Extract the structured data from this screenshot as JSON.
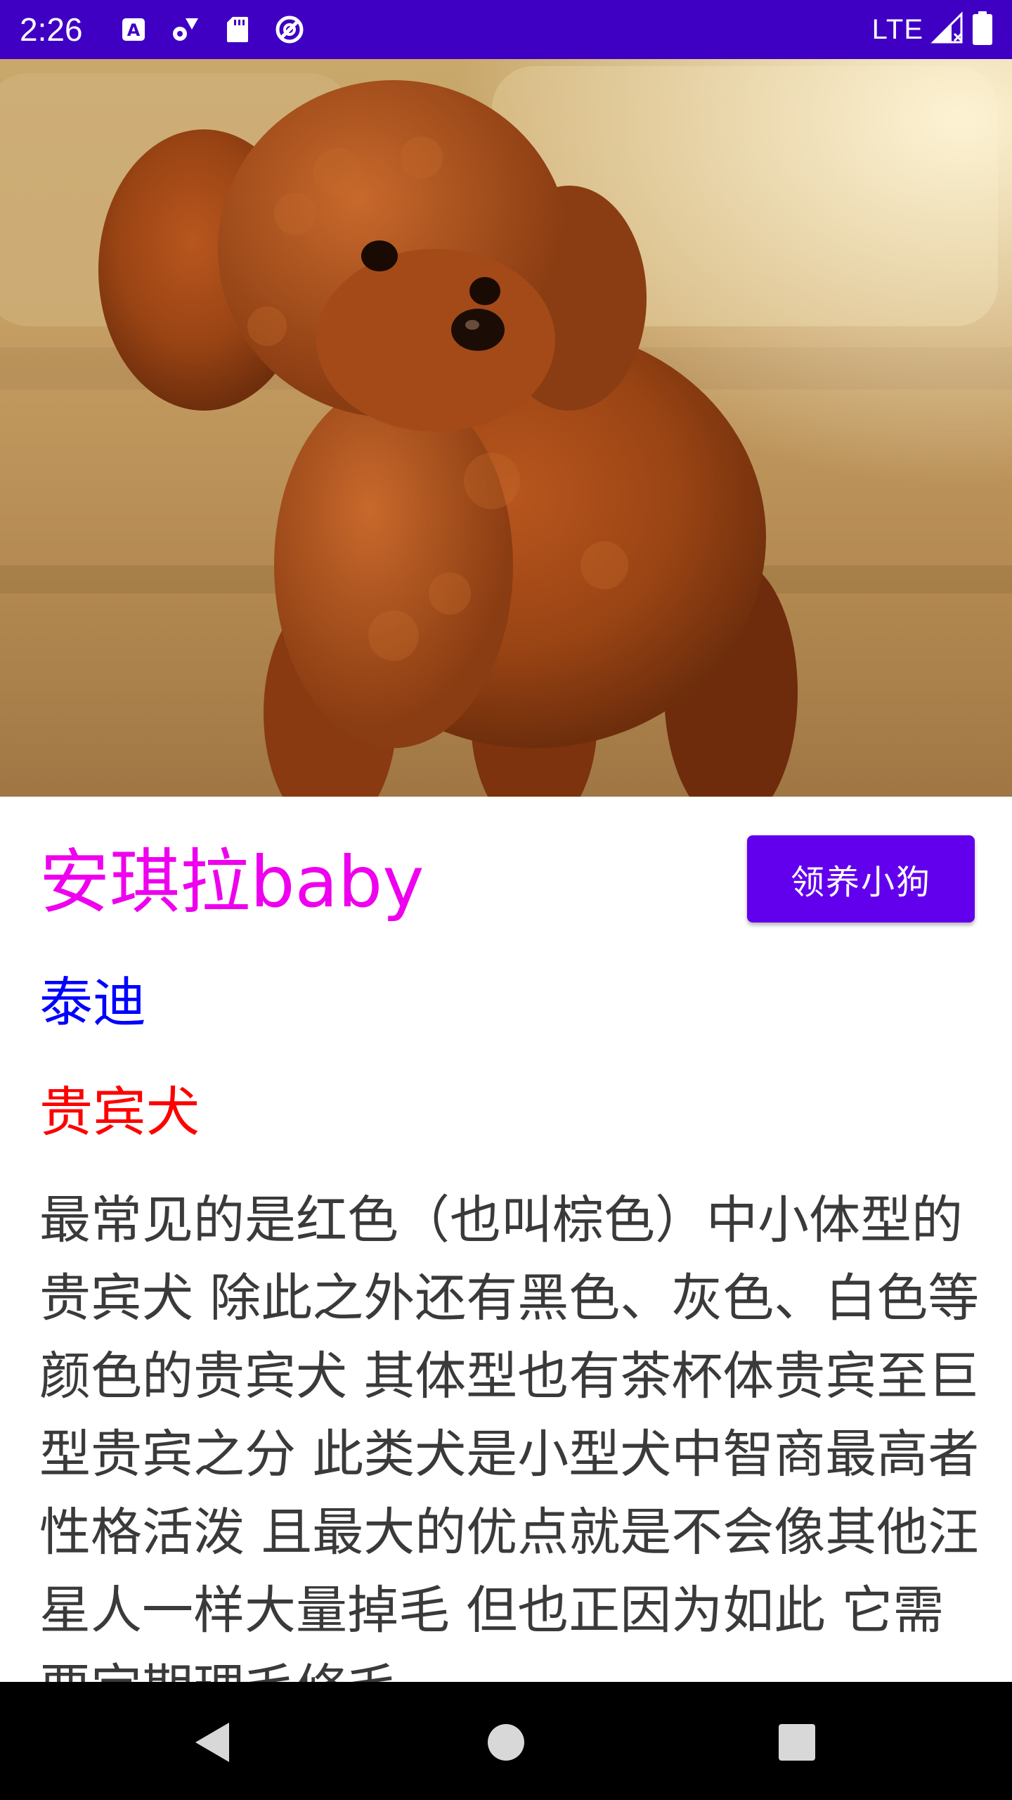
{
  "status_bar": {
    "time": "2:26",
    "network": "LTE",
    "icons": [
      "app-a-icon",
      "settings-sync-icon",
      "sd-card-icon",
      "do-not-disturb-icon",
      "signal-icon",
      "battery-icon"
    ]
  },
  "hero_image": {
    "subject": "red-brown-poodle-photo"
  },
  "dog": {
    "name": "安琪拉baby",
    "breed": "泰迪",
    "breed_alt": "贵宾犬",
    "description": "最常见的是红色（也叫棕色）中小体型的贵宾犬 除此之外还有黑色、灰色、白色等颜色的贵宾犬 其体型也有茶杯体贵宾至巨型贵宾之分 此类犬是小型犬中智商最高者 性格活泼 且最大的优点就是不会像其他汪星人一样大量掉毛 但也正因为如此 它需要定期理毛修毛"
  },
  "actions": {
    "adopt_label": "领养小狗"
  },
  "colors": {
    "status_bar": "#3f00c4",
    "button": "#6200ee",
    "name": "#ee00ee",
    "breed": "#0000ff",
    "breed_alt": "#ff0000",
    "body_text": "#3a3a3a"
  },
  "nav_bar": {
    "buttons": [
      "back-icon",
      "home-icon",
      "recents-icon"
    ]
  }
}
